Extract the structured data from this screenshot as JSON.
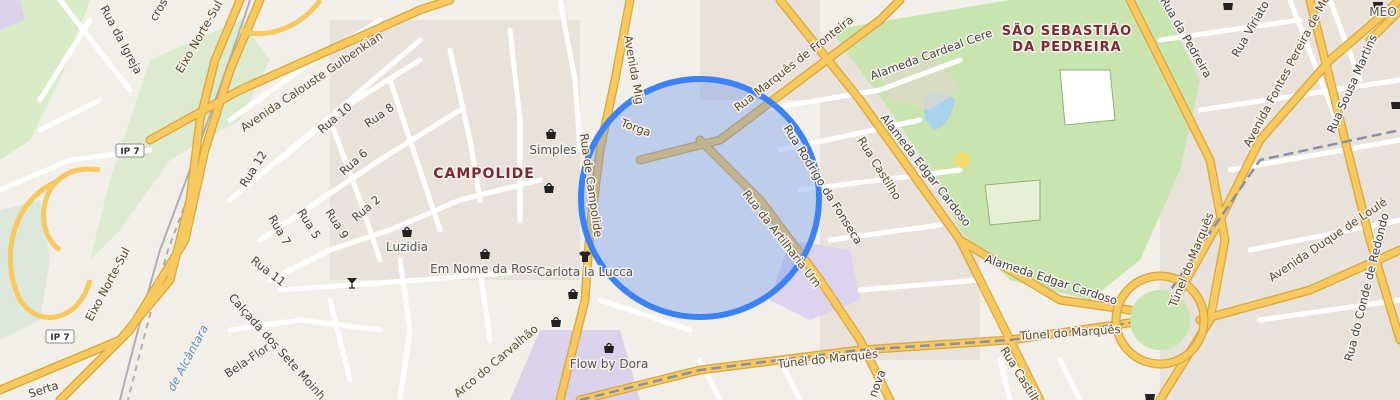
{
  "areas": {
    "campolide": "CAMPOLIDE",
    "sao_sebastiao_line1": "SÃO SEBASTIÃO",
    "sao_sebastiao_line2": "DA PEDREIRA"
  },
  "pois": {
    "simples": "Simples",
    "luzidia": "Luzidia",
    "em_nome_da_rosa": "Em Nome da Rosa",
    "carlota": "Carlota la Lucca",
    "flow_by_dora": "Flow by Dora",
    "meo": "MEO"
  },
  "streets": {
    "rua_da_igreja": "Rua da Igreja",
    "eixo_norte_sul_1": "Eixo Norte-Sul",
    "eixo_norte_sul_2": "Eixo Norte-Sul",
    "av_calouste": "Avenida Calouste Gulbenkian",
    "rua_10": "Rua 10",
    "rua_8": "Rua 8",
    "rua_6": "Rua 6",
    "rua_12": "Rua 12",
    "rua_5": "Rua 5",
    "rua_9": "Rua 9",
    "rua_2": "Rua 2",
    "rua_7": "Rua 7",
    "rua_11": "Rua 11",
    "avenida_miguel": "Avenida Mig",
    "torga": "Torga",
    "rua_campolide": "Rua de Campolide",
    "rua_marques_fronteira": "Rua Marquês de Fronteira",
    "alameda_cardeal": "Alameda Cardeal Cere",
    "rua_pedreira": "Rua da Pedreira",
    "rua_viriato": "Rua Viriato",
    "av_fontes": "Avenida Fontes Pereira de Mel",
    "rua_sousa_martins": "Rua Sousa Martins",
    "rua_rodrigo": "Rua Rodrigo da Fonseca",
    "rua_castilho_1": "Rua Castilho",
    "alameda_edgar_1": "Alameda Edgar Cardoso",
    "alameda_edgar_2": "Alameda Edgar Cardoso",
    "rua_artilharia": "Rua da Artilharia Um",
    "tunel_marques_1": "Túnel do Marquês",
    "tunel_marques_2": "Túnel do Marquês",
    "tunel_marques_3": "Túnel do Marquês",
    "rua_castilho_2": "Rua Castilho",
    "av_duque_loule": "Avenida Duque de Loulé",
    "rua_conde_redondo": "Rua do Conde de Redondo",
    "arco_carvalhao": "Arco do Carvalhão",
    "calcada_sete_moinhos": "Calçada dos Sete Moinh",
    "bela_flor": "Bela-Flor",
    "de_alcantara": "de Alcântara",
    "serta": "Serta",
    "nova": "nova",
    "cros": "cros"
  },
  "shields": {
    "ip7_top": "IP 7",
    "ip7_bottom": "IP 7"
  },
  "colors": {
    "background": "#f2efe9",
    "park": "#c8e5b0",
    "major_road": "#f7c95e",
    "major_road_casing": "#d9a63a",
    "minor_road": "#ffffff",
    "railway": "#8a8aa0",
    "area_label": "#7a2a35",
    "radius_stroke": "#3b82f6",
    "radius_fill": "#5b8ff0"
  },
  "icons": {
    "shop": "shopping-bag-icon",
    "clothes": "shirt-icon",
    "bar": "cocktail-icon"
  }
}
